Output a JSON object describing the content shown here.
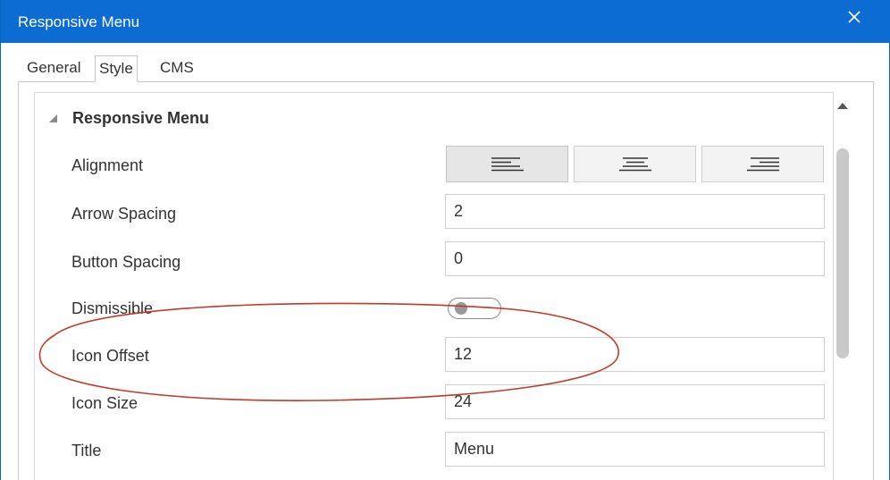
{
  "window": {
    "title": "Responsive Menu",
    "close_icon": "close-icon"
  },
  "tabs": [
    {
      "label": "General",
      "active": false
    },
    {
      "label": "Style",
      "active": true
    },
    {
      "label": "CMS",
      "active": false
    }
  ],
  "section": {
    "title": "Responsive Menu",
    "expanded": true
  },
  "properties": {
    "alignment": {
      "label": "Alignment",
      "options": [
        "left",
        "center",
        "right"
      ],
      "selected": "left"
    },
    "arrow_spacing": {
      "label": "Arrow Spacing",
      "value": "2"
    },
    "button_spacing": {
      "label": "Button Spacing",
      "value": "0"
    },
    "dismissible": {
      "label": "Dismissible",
      "on": false
    },
    "icon_offset": {
      "label": "Icon Offset",
      "value": "12"
    },
    "icon_size": {
      "label": "Icon Size",
      "value": "24"
    },
    "title": {
      "label": "Title",
      "value": "Menu"
    }
  },
  "colors": {
    "titlebar": "#0c6cd2",
    "annotation": "#c0392b"
  }
}
